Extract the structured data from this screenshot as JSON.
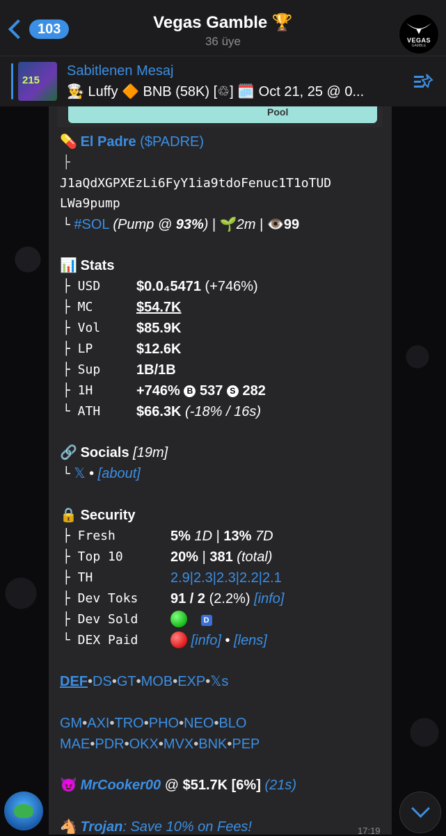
{
  "header": {
    "back_count": "103",
    "title": "Vegas Gamble 🏆",
    "subtitle": "36 üye",
    "avatar_brand": "VEGAS",
    "avatar_sub": "GAMBLE"
  },
  "pinned": {
    "title": "Sabitlenen Mesaj",
    "text": "👨‍🍳 Luffy 🔶 BNB (58K) [♲] 🗓️ Oct 21, 25 @ 0...",
    "thumb_text": "215"
  },
  "image_preview": {
    "word": "Pool"
  },
  "message": {
    "token_emoji": "💊",
    "token_name": "El Padre",
    "token_ticker": "($PADRE)",
    "tree_top": "├",
    "address_1": "J1aQdXGPXEzLi6FyY1ia9tdoFenuc1T1oTUD",
    "address_2": "LWa9pump",
    "chain_prefix": "└",
    "chain_tag": "#SOL",
    "chain_info": "(Pump @ ",
    "chain_pct": "93%",
    "chain_close": ")",
    "sep": "|",
    "age_emoji": "🌱",
    "age": "2m",
    "views_emoji": "👁️",
    "views": "99",
    "stats_emoji": "📊",
    "stats_title": "Stats",
    "stats": [
      {
        "key": "├ USD",
        "value": "$0.0₄5471",
        "extra": " (+746%)"
      },
      {
        "key": "├ MC",
        "value": "$54.7K",
        "extra": ""
      },
      {
        "key": "├ Vol",
        "value": "$85.9K",
        "extra": ""
      },
      {
        "key": "├ LP",
        "value": "$12.6K",
        "extra": ""
      },
      {
        "key": "├ Sup",
        "value": "1B/1B",
        "extra": ""
      },
      {
        "key": "├ 1H",
        "value": "+746%",
        "b_count": "537",
        "s_count": "282"
      },
      {
        "key": "└ ATH",
        "value": "$66.3K",
        "extra": " (-18% / 16s)"
      }
    ],
    "coin_b": "B",
    "coin_s": "S",
    "socials_emoji": "🔗",
    "socials_title": "Socials",
    "socials_age": "[19m]",
    "socials_prefix": "└",
    "socials_x": "𝕏",
    "socials_dot": "•",
    "socials_about": "[about]",
    "security_emoji": "🔒",
    "security_title": "Security",
    "sec_fresh_key": "├ Fresh",
    "sec_fresh_a": "5%",
    "sec_fresh_a_unit": "1D",
    "sec_fresh_b": "13%",
    "sec_fresh_b_unit": "7D",
    "sec_top_key": "├ Top 10",
    "sec_top_a": "20%",
    "sec_top_b": "381",
    "sec_top_note": "(total)",
    "sec_th_key": "├ TH",
    "sec_th_vals": "2.9|2.3|2.3|2.2|2.1",
    "sec_devtoks_key": "├ Dev Toks",
    "sec_devtoks_val": "91 / 2",
    "sec_devtoks_pct": "(2.2%)",
    "sec_devtoks_info": "[info]",
    "sec_devsold_key": "├ Dev Sold",
    "sec_devsold_badge": "D",
    "sec_dex_key": "└ DEX Paid",
    "sec_dex_info": "[info]",
    "sec_dex_dot": "•",
    "sec_dex_lens": "[lens]",
    "links_row1": [
      "DEF",
      "DS",
      "GT",
      "MOB",
      "EXP",
      "𝕏s"
    ],
    "links_row2": [
      "GM",
      "AXI",
      "TRO",
      "PHO",
      "NEO",
      "BLO"
    ],
    "links_row3": [
      "MAE",
      "PDR",
      "OKX",
      "MVX",
      "BNK",
      "PEP"
    ],
    "link_sep": "•",
    "caller_emoji": "😈",
    "caller_name": "MrCooker00",
    "caller_at": " @ ",
    "caller_value": "$51.7K [6%]",
    "caller_age": "(21s)",
    "promo_emoji": "🐴",
    "promo_name": "Trojan",
    "promo_text": ": Save 10% on Fees!",
    "time": "17:19"
  }
}
